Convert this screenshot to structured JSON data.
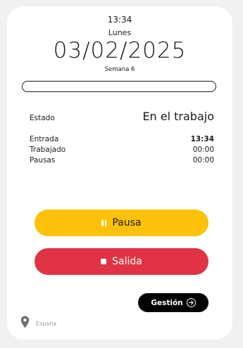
{
  "header": {
    "time": "13:34",
    "weekday": "Lunes",
    "date": "03/02/2025",
    "week": "Semana 6"
  },
  "progress": {
    "fraction": 0
  },
  "status": {
    "label": "Estado",
    "value": "En el trabajo"
  },
  "details": [
    {
      "label": "Entrada",
      "value": "13:34"
    },
    {
      "label": "Trabajado",
      "value": "00:00"
    },
    {
      "label": "Pausas",
      "value": "00:00"
    }
  ],
  "actions": {
    "pausa_label": "Pausa",
    "salida_label": "Salida",
    "gestion_label": "Gestión"
  },
  "location": {
    "text": "España",
    "icon": "location-pin-icon"
  },
  "colors": {
    "pausa": "#fec10a",
    "salida": "#e03444",
    "gestion": "#000000"
  }
}
